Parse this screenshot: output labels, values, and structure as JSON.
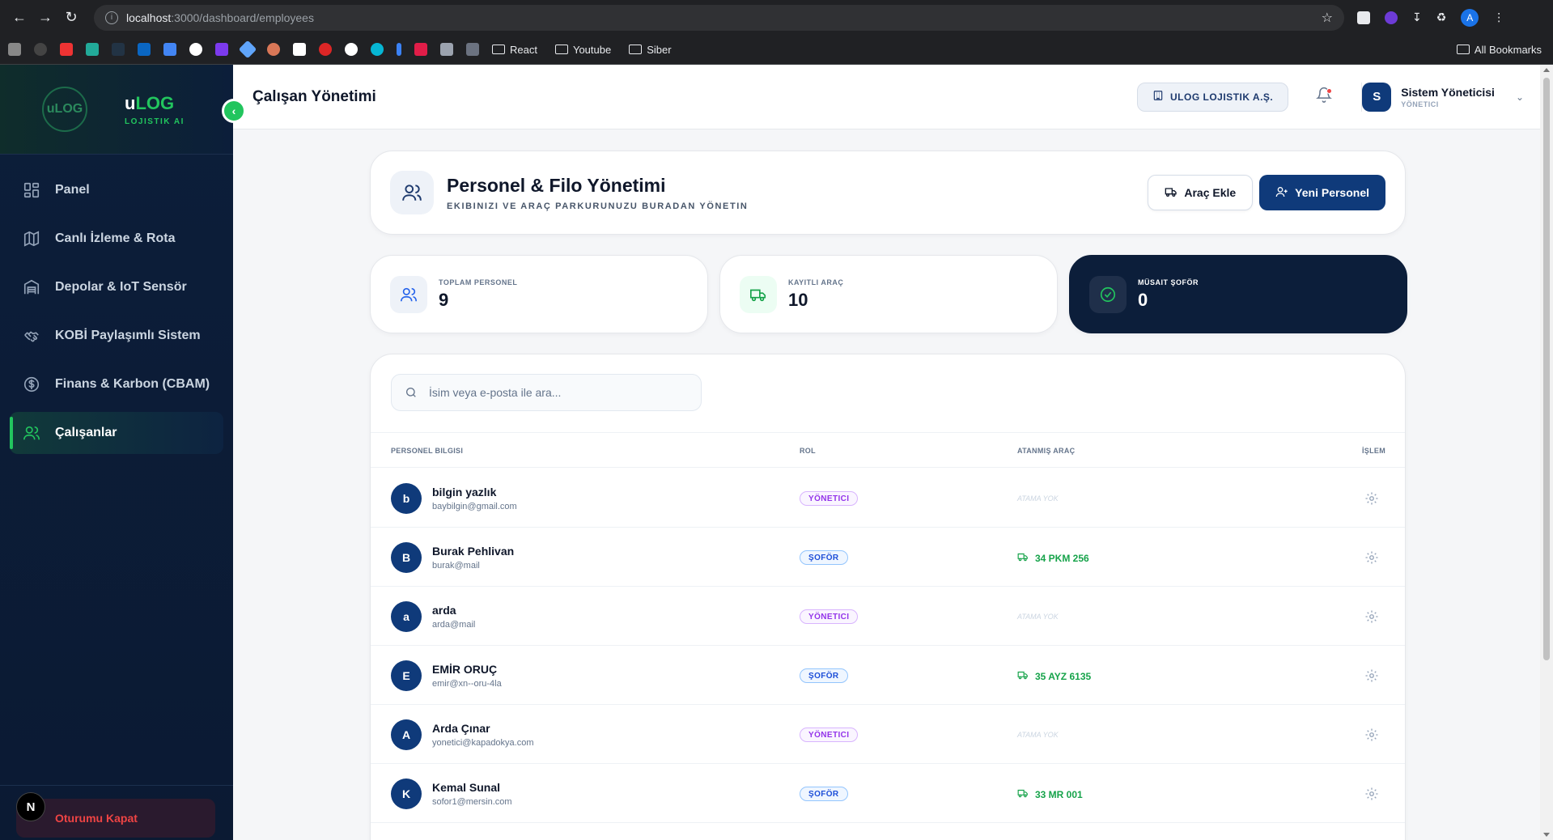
{
  "browser": {
    "url_host": "localhost",
    "url_path": ":3000/dashboard/employees",
    "profile_initial": "A",
    "bookmark_folders": [
      "React",
      "Youtube",
      "Siber"
    ],
    "all_bookmarks": "All Bookmarks"
  },
  "sidebar": {
    "brand_prefix": "u",
    "brand_main": "LOG",
    "brand_sub": "LOJISTIK AI",
    "logo_text": "uLOG",
    "items": [
      {
        "label": "Panel",
        "icon": "grid-icon"
      },
      {
        "label": "Canlı İzleme & Rota",
        "icon": "map-icon"
      },
      {
        "label": "Depolar & IoT Sensör",
        "icon": "warehouse-icon"
      },
      {
        "label": "KOBİ Paylaşımlı Sistem",
        "icon": "handshake-icon"
      },
      {
        "label": "Finans & Karbon (CBAM)",
        "icon": "dollar-icon"
      },
      {
        "label": "Çalışanlar",
        "icon": "users-icon"
      }
    ],
    "logout": "Oturumu Kapat",
    "next_badge": "N"
  },
  "header": {
    "title": "Çalışan Yönetimi",
    "company": "ULOG LOJISTIK A.Ş.",
    "user_initial": "S",
    "user_name": "Sistem Yöneticisi",
    "user_role": "YÖNETICI"
  },
  "hero": {
    "title": "Personel & Filo Yönetimi",
    "subtitle": "EKIBINIZI VE ARAÇ PARKURUNUZU BURADAN YÖNETIN",
    "add_vehicle": "Araç Ekle",
    "new_staff": "Yeni Personel"
  },
  "stats": [
    {
      "label": "TOPLAM PERSONEL",
      "value": "9"
    },
    {
      "label": "KAYITLI ARAÇ",
      "value": "10"
    },
    {
      "label": "MÜSAIT ŞOFÖR",
      "value": "0"
    }
  ],
  "search": {
    "placeholder": "İsim veya e-posta ile ara..."
  },
  "table": {
    "headers": [
      "PERSONEL BILGISI",
      "ROL",
      "ATANMIŞ ARAÇ",
      "İŞLEM"
    ],
    "rows": [
      {
        "initial": "b",
        "name": "bilgin yazlık",
        "email": "baybilgin@gmail.com",
        "role": "YÖNETICI",
        "role_type": "admin",
        "vehicle": "ATAMA YOK"
      },
      {
        "initial": "B",
        "name": "Burak Pehlivan",
        "email": "burak@mail",
        "role": "ŞOFÖR",
        "role_type": "driver",
        "vehicle": "34 PKM 256"
      },
      {
        "initial": "a",
        "name": "arda",
        "email": "arda@mail",
        "role": "YÖNETICI",
        "role_type": "admin",
        "vehicle": "ATAMA YOK"
      },
      {
        "initial": "E",
        "name": "EMİR ORUÇ",
        "email": "emir@xn--oru-4la",
        "role": "ŞOFÖR",
        "role_type": "driver",
        "vehicle": "35 AYZ 6135"
      },
      {
        "initial": "A",
        "name": "Arda Çınar",
        "email": "yonetici@kapadokya.com",
        "role": "YÖNETICI",
        "role_type": "admin",
        "vehicle": "ATAMA YOK"
      },
      {
        "initial": "K",
        "name": "Kemal Sunal",
        "email": "sofor1@mersin.com",
        "role": "ŞOFÖR",
        "role_type": "driver",
        "vehicle": "33 MR 001"
      }
    ]
  },
  "colors": {
    "accent_green": "#22c55e",
    "primary_navy": "#0f3a7a",
    "sidebar_bg": "#0c1e3a"
  }
}
